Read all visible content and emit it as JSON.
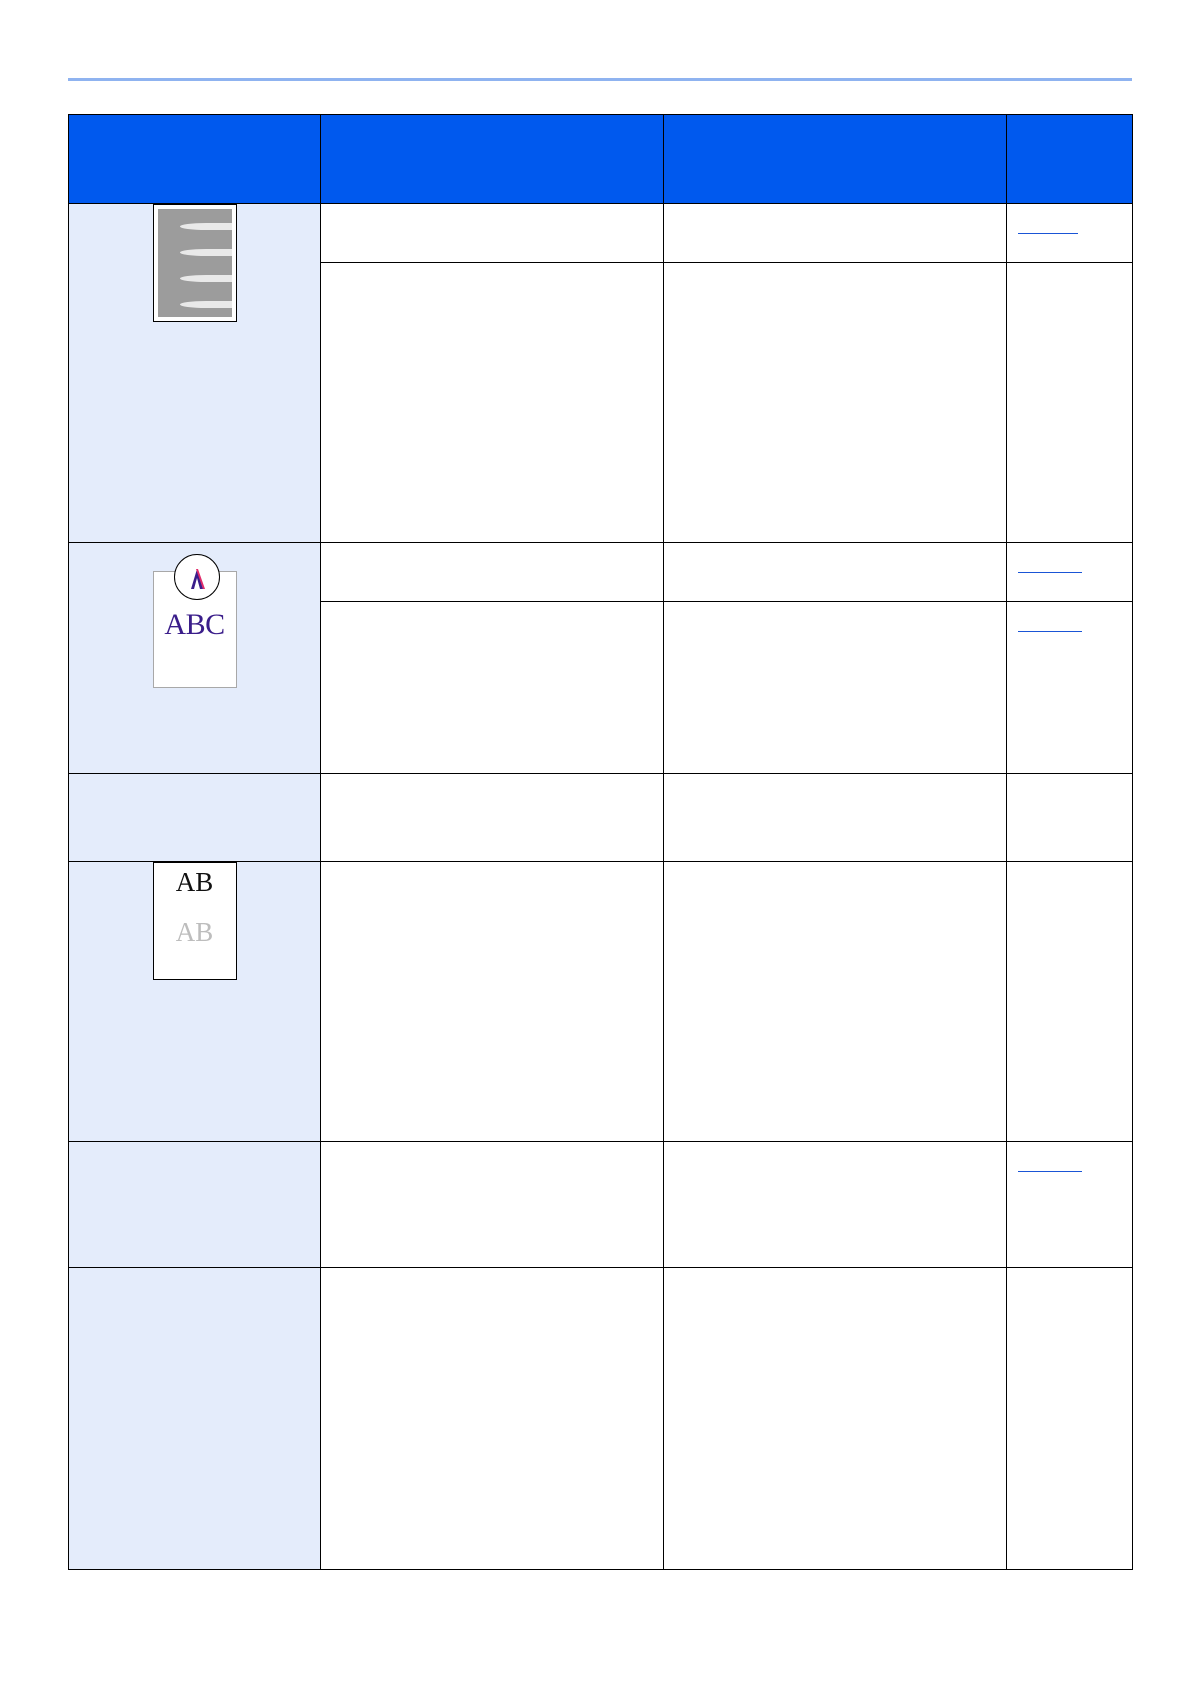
{
  "table": {
    "columns": [
      "",
      "",
      "",
      ""
    ],
    "rows": [
      {
        "symptom": "smear-sample",
        "sub": [
          {
            "ref": true
          },
          {
            "ref": false
          }
        ]
      },
      {
        "symptom": "abc-sample",
        "sub": [
          {
            "ref": true
          },
          {
            "ref": true
          }
        ]
      },
      {
        "symptom": "",
        "sub": [
          {
            "ref": false
          }
        ]
      },
      {
        "symptom": "ab-sample",
        "sub": [
          {
            "ref": false
          }
        ]
      },
      {
        "symptom": "",
        "sub": [
          {
            "ref": true
          }
        ]
      },
      {
        "symptom": "",
        "sub": [
          {
            "ref": false
          }
        ]
      }
    ]
  },
  "samples": {
    "abc_text": "ABC",
    "ab_dark": "AB",
    "ab_light": "AB"
  },
  "colors": {
    "header_blue": "#0059ee",
    "symptom_bg": "#e4ecfb",
    "top_rule": "#8fb3f0",
    "link_blue": "#1a55d6",
    "abc_text": "#3a1d8a"
  }
}
